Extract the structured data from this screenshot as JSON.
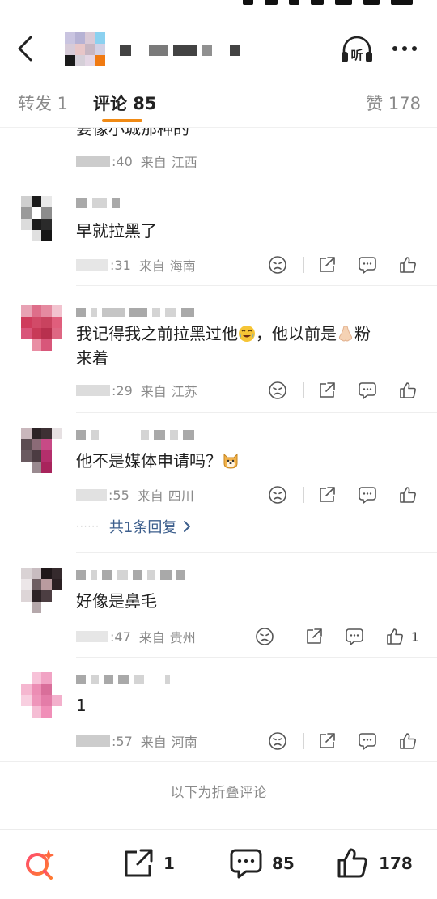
{
  "header": {
    "listen_label": "听"
  },
  "tabs": {
    "forward": "转发 1",
    "comments": "评论 85",
    "likes": "赞 178"
  },
  "top_partial": {
    "text": "要像小城那种的",
    "time": ":40",
    "source": "来自",
    "location": "江西"
  },
  "comments": [
    {
      "text": "早就拉黑了",
      "time": ":31",
      "source": "来自",
      "location": "海南",
      "like_count": ""
    },
    {
      "text_before": "我记得我之前拉黑过他",
      "text_mid": "，他以前是",
      "text_after": "粉",
      "text_line2": "来着",
      "time": ":29",
      "source": "来自",
      "location": "江苏",
      "like_count": ""
    },
    {
      "text": "他不是媒体申请吗？",
      "time": ":55",
      "source": "来自",
      "location": "四川",
      "like_count": "",
      "replies": "共1条回复"
    },
    {
      "text": "好像是鼻毛",
      "time": ":47",
      "source": "来自",
      "location": "贵州",
      "like_count": "1"
    },
    {
      "text": "1",
      "time": ":57",
      "source": "来自",
      "location": "河南",
      "like_count": ""
    }
  ],
  "folded_label": "以下为折叠评论",
  "bottom_bar": {
    "forward_count": "1",
    "comment_count": "85",
    "like_count": "178"
  },
  "colors": {
    "accent": "#f08a14",
    "link": "#3c5e8c",
    "meta": "#8a8a8a"
  },
  "icons": [
    "back-icon",
    "headphones-icon",
    "more-icon",
    "dislike-face-icon",
    "share-icon",
    "comment-icon",
    "like-icon",
    "search-sparkle-icon",
    "chevron-right-icon"
  ]
}
